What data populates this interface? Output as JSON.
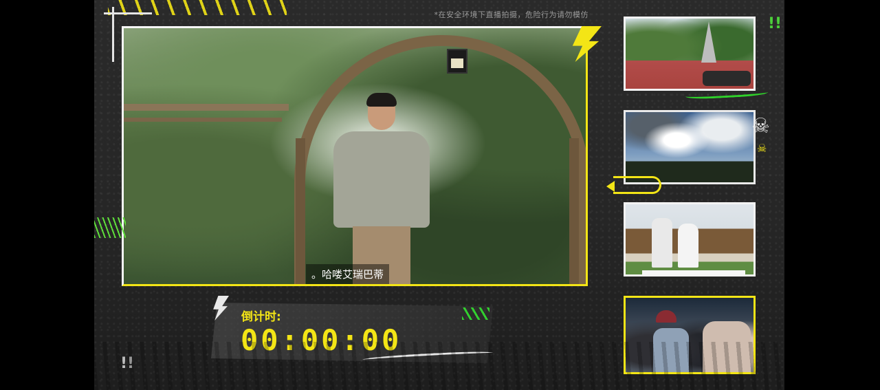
{
  "notice": "*在安全环境下直播拍摄，危险行为请勿模仿",
  "main_video": {
    "subtitle": "。哈喽艾瑞巴蒂"
  },
  "countdown": {
    "label": "倒计时:",
    "time": "00:00:00"
  },
  "icons": {
    "skull": "skull-icon",
    "bolt": "lightning-bolt-icon",
    "arrow": "curved-arrow-icon",
    "exclamation": "exclamation-icon"
  },
  "colors": {
    "accent_yellow": "#f3e516",
    "accent_green": "#2fd22a",
    "background": "#262626",
    "frame_white": "#f6f6f6"
  }
}
